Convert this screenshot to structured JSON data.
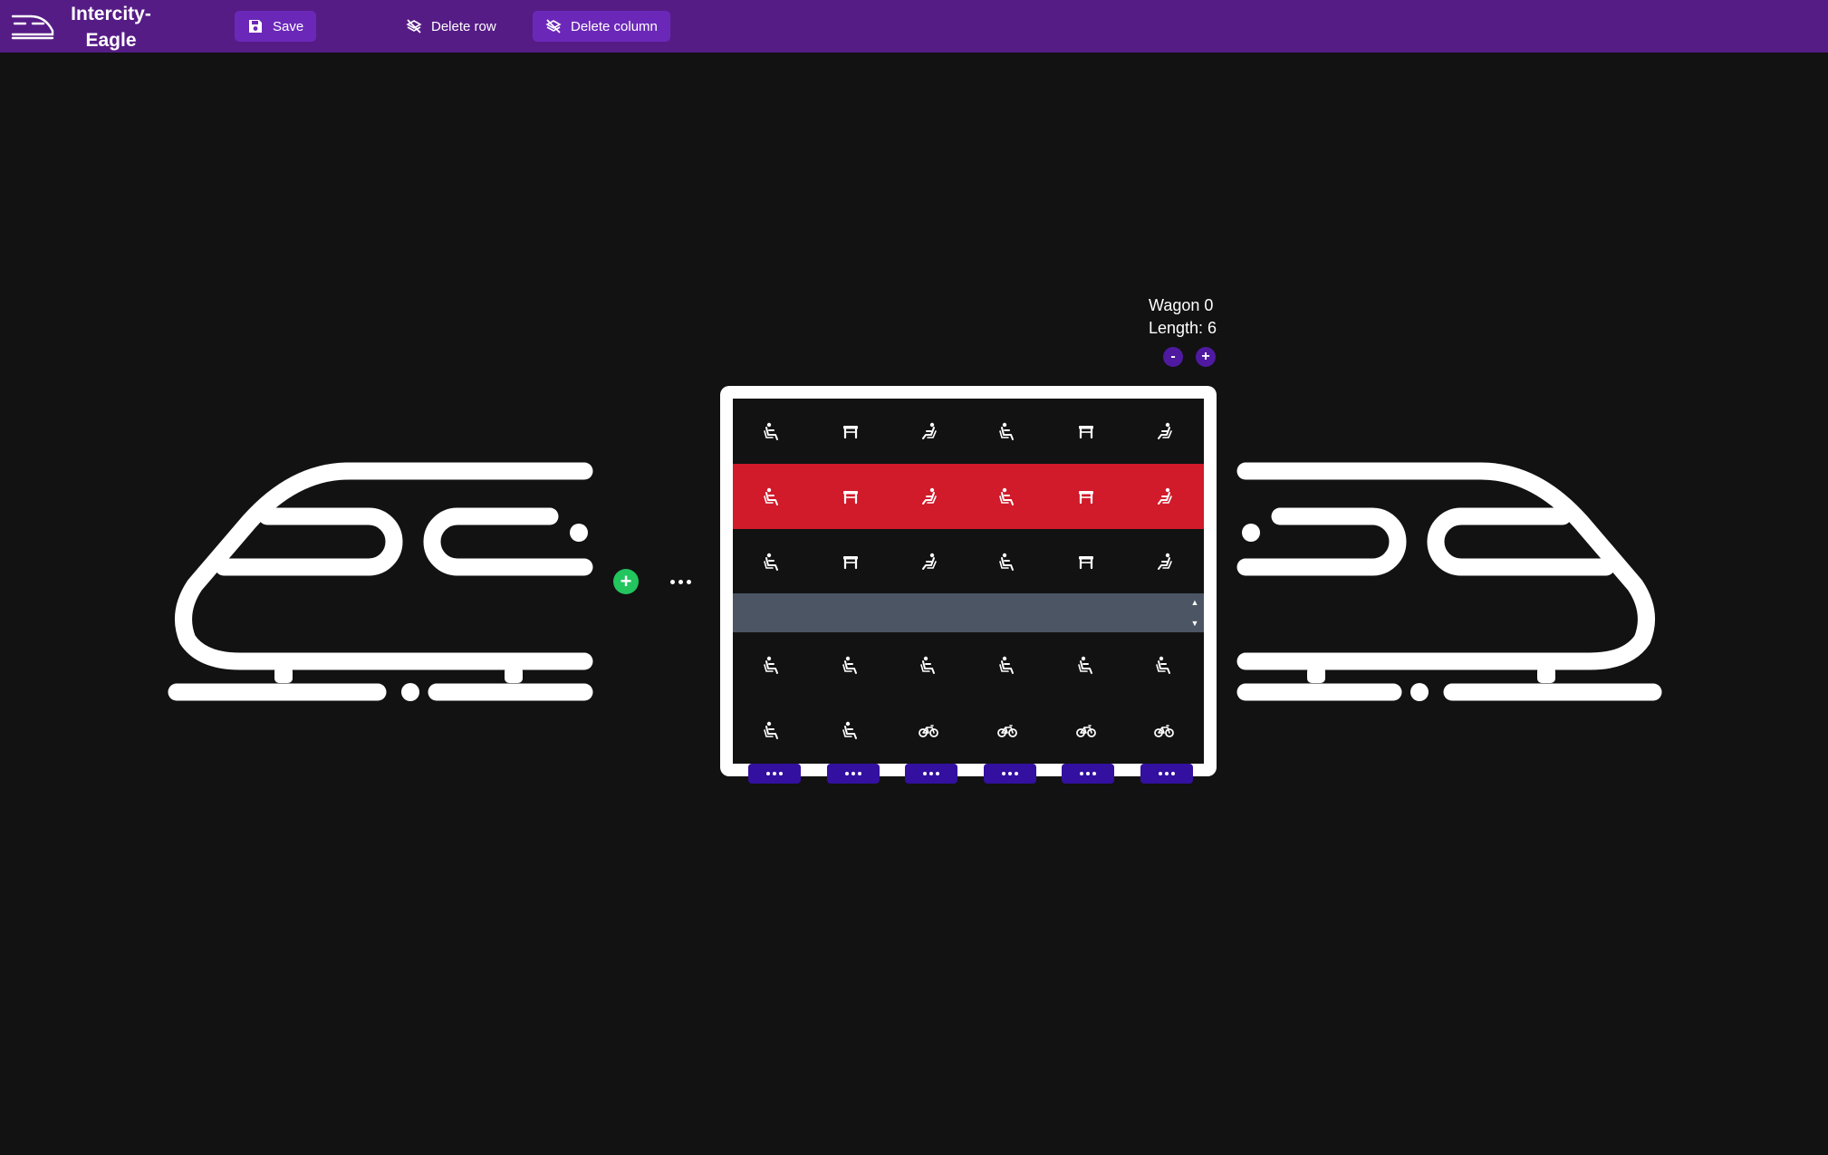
{
  "app": {
    "title": "Intercity-Eagle",
    "logo_icon": "train-icon"
  },
  "toolbar": {
    "save_label": "Save",
    "delete_row_label": "Delete row",
    "delete_column_label": "Delete column"
  },
  "wagon": {
    "name": "Wagon 0",
    "length_label": "Length: 6",
    "decrease_label": "-",
    "increase_label": "+",
    "selected_row": 1,
    "rows": [
      [
        "seat-icon",
        "table-icon",
        "recliner-icon",
        "seat-icon",
        "table-icon",
        "recliner-icon"
      ],
      [
        "seat-icon",
        "table-icon",
        "recliner-icon",
        "seat-icon",
        "table-icon",
        "recliner-icon"
      ],
      [
        "seat-icon",
        "table-icon",
        "recliner-icon",
        "seat-icon",
        "table-icon",
        "recliner-icon"
      ],
      [
        "seat-icon",
        "seat-icon",
        "seat-icon",
        "seat-icon",
        "seat-icon",
        "seat-icon"
      ],
      [
        "seat-icon",
        "seat-icon",
        "bicycle-icon",
        "bicycle-icon",
        "bicycle-icon",
        "bicycle-icon"
      ]
    ]
  },
  "add_wagon_label": "+",
  "colors": {
    "topbar": "#561c86",
    "accent_button": "#6b28b8",
    "selected_row": "#d11a2a",
    "gap_row": "#4b5563",
    "column_button": "#3310a0",
    "add_button": "#22c55e",
    "background": "#121212"
  }
}
